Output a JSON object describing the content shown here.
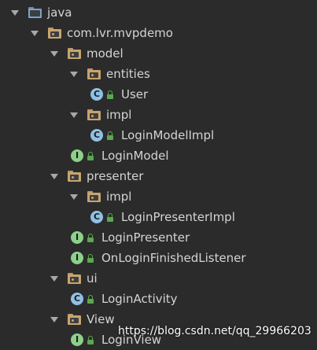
{
  "tree": [
    {
      "depth": 0,
      "arrow": true,
      "icon": "source-folder-icon",
      "kind": "folder-blue",
      "label": "java"
    },
    {
      "depth": 1,
      "arrow": true,
      "icon": "package-folder-icon",
      "kind": "folder",
      "label": "com.lvr.mvpdemo"
    },
    {
      "depth": 2,
      "arrow": true,
      "icon": "package-folder-icon",
      "kind": "folder",
      "label": "model"
    },
    {
      "depth": 3,
      "arrow": true,
      "icon": "package-folder-icon",
      "kind": "folder",
      "label": "entities"
    },
    {
      "depth": 4,
      "arrow": false,
      "icon": "class-icon",
      "kind": "class",
      "label": "User"
    },
    {
      "depth": 3,
      "arrow": true,
      "icon": "package-folder-icon",
      "kind": "folder",
      "label": "impl"
    },
    {
      "depth": 4,
      "arrow": false,
      "icon": "class-icon",
      "kind": "class",
      "label": "LoginModelImpl"
    },
    {
      "depth": 3,
      "arrow": false,
      "icon": "interface-icon",
      "kind": "interface",
      "label": "LoginModel"
    },
    {
      "depth": 2,
      "arrow": true,
      "icon": "package-folder-icon",
      "kind": "folder",
      "label": "presenter"
    },
    {
      "depth": 3,
      "arrow": true,
      "icon": "package-folder-icon",
      "kind": "folder",
      "label": "impl"
    },
    {
      "depth": 4,
      "arrow": false,
      "icon": "class-icon",
      "kind": "class",
      "label": "LoginPresenterImpl"
    },
    {
      "depth": 3,
      "arrow": false,
      "icon": "interface-icon",
      "kind": "interface",
      "label": "LoginPresenter"
    },
    {
      "depth": 3,
      "arrow": false,
      "icon": "interface-icon",
      "kind": "interface",
      "label": "OnLoginFinishedListener"
    },
    {
      "depth": 2,
      "arrow": true,
      "icon": "package-folder-icon",
      "kind": "folder",
      "label": "ui"
    },
    {
      "depth": 3,
      "arrow": false,
      "icon": "class-icon",
      "kind": "class",
      "label": "LoginActivity"
    },
    {
      "depth": 2,
      "arrow": true,
      "icon": "package-folder-icon",
      "kind": "folder",
      "label": "View"
    },
    {
      "depth": 3,
      "arrow": false,
      "icon": "interface-icon",
      "kind": "interface",
      "label": "LoginView"
    }
  ],
  "badge_letters": {
    "class": "C",
    "interface": "I"
  },
  "watermark": "https://blog.csdn.net/qq_29966203",
  "colors": {
    "background": "#2b2b2b",
    "text": "#d4d4d4",
    "folder": "#c8a46e",
    "class_badge": "#8fc1e6",
    "interface_badge": "#8cd08a",
    "lock": "#5aa84f"
  }
}
